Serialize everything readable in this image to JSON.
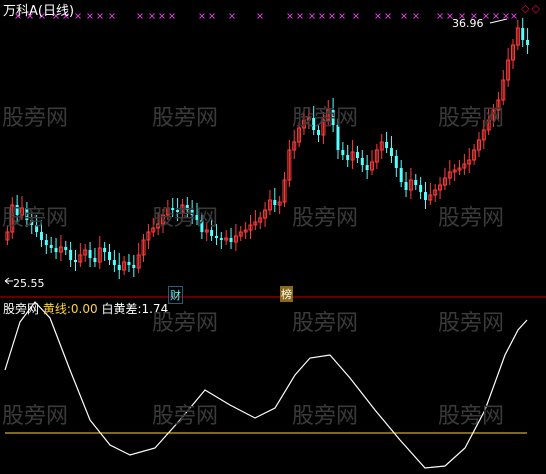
{
  "stock": {
    "title": "万科A(日线)"
  },
  "main": {
    "high_label": "36.96",
    "low_label": "25.55",
    "marker_cai": "财",
    "marker_bang": "榜"
  },
  "indicator": {
    "name": "股旁网",
    "yellow_label": "黄线:",
    "yellow_value": "0.00",
    "white_label": "白黄差:",
    "white_value": "1.74"
  },
  "watermark": "股旁网",
  "colors": {
    "up": "#ff3c3c",
    "down": "#54ffff",
    "cross": "#ffffff",
    "signal": "#d040d0",
    "yellow_line": "#ffd23a",
    "white_line": "#ffffff",
    "separator": "#c00000"
  },
  "window_icons": [
    "diamond-icon",
    "diamond-icon"
  ]
}
